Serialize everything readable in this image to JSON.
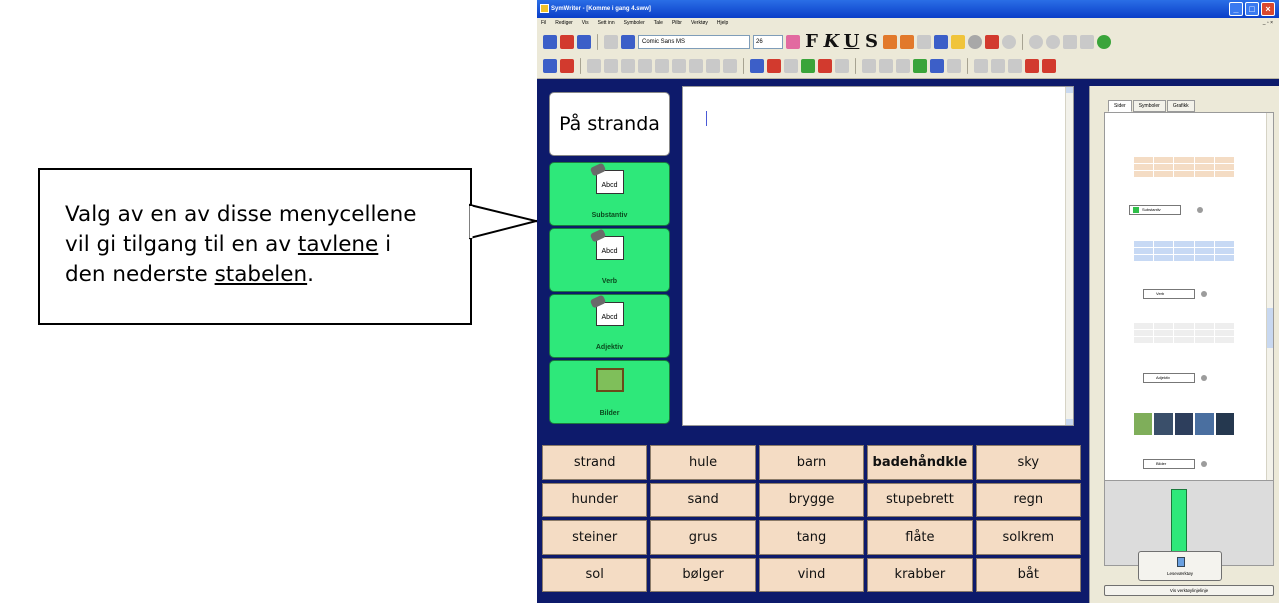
{
  "callout": {
    "line1": "Valg av en av disse menycellene",
    "line2": "vil gi tilgang til en av ",
    "line2_link": "tavlene",
    "line2_tail": " i",
    "line3": "den nederste ",
    "line3_link": "stabelen",
    "line3_tail": "."
  },
  "window": {
    "title": "SymWriter - [Komme i gang 4.sww]",
    "menu": [
      "Fil",
      "Rediger",
      "Vis",
      "Sett inn",
      "Symboler",
      "Tale",
      "Pilbr",
      "Verktøy",
      "Hjelp"
    ]
  },
  "toolbar": {
    "font": "Comic Sans MS",
    "size": "26",
    "bold": "F",
    "italic": "K",
    "underline": "U",
    "strike": "S"
  },
  "menu_cells": {
    "title": "På  stranda",
    "items": [
      {
        "label": "Substantiv",
        "symbol": "Abcd"
      },
      {
        "label": "Verb",
        "symbol": "Abcd"
      },
      {
        "label": "Adjektiv",
        "symbol": "Abcd"
      },
      {
        "label": "Bilder",
        "symbol": ""
      }
    ]
  },
  "word_grid": [
    [
      "strand",
      "hule",
      "barn",
      "badehåndkle",
      "sky"
    ],
    [
      "hunder",
      "sand",
      "brygge",
      "stupebrett",
      "regn"
    ],
    [
      "steiner",
      "grus",
      "tang",
      "flåte",
      "solkrem"
    ],
    [
      "sol",
      "bølger",
      "vind",
      "krabber",
      "båt"
    ]
  ],
  "right_panel": {
    "tabs": [
      "Sider",
      "Symboler",
      "Grafikk"
    ],
    "board_labels": [
      "Substantiv",
      "Verb",
      "Adjektiv",
      "Bilder"
    ],
    "lecture_button": "Leseværktøy",
    "verbal_button": "Vis verktøylinjelinje"
  },
  "colors": {
    "menu_cell_green": "#2ee87a",
    "word_cell_peach": "#f4dcc4",
    "background_navy": "#0d1a6b"
  }
}
